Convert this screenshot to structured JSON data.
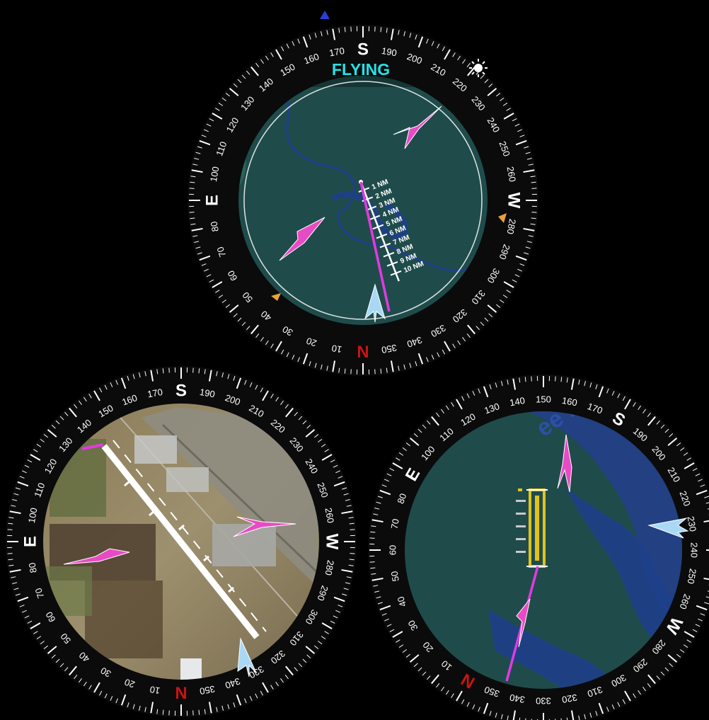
{
  "colors": {
    "background": "#000000",
    "bezel": "#0b0b0b",
    "tick": "#ffffff",
    "north": "#c81414",
    "map_water": "#1f4c4b",
    "river": "#1e3f8a",
    "route": "#e23ae0",
    "traffic": "#e74bc4",
    "ownship": "#a9d8f5",
    "status_text": "#27e0e6",
    "runway_yellow": "#e2c21c",
    "sun": "#ffffff",
    "bearing_orange": "#e7a23a",
    "bearing_blue": "#2b3fd6"
  },
  "top_dial": {
    "status_label": "FLYING",
    "rotation_deg": 180,
    "cardinals": {
      "N": "N",
      "E": "E",
      "S": "S",
      "W": "W"
    },
    "range_rings": [
      "1 NM",
      "2 NM",
      "3 NM",
      "4 NM",
      "5 NM",
      "6 NM",
      "7 NM",
      "8 NM",
      "9 NM",
      "10 NM"
    ],
    "icons": [
      "sun-icon",
      "orange-bearing-bug-icon",
      "blue-bearing-bug-icon",
      "ownship-icon",
      "traffic-icon"
    ]
  },
  "left_dial": {
    "rotation_deg": 180,
    "cardinals": {
      "N": "N",
      "E": "E",
      "S": "S",
      "W": "W"
    },
    "map_style": "satellite-airfield",
    "icons": [
      "ownship-icon",
      "traffic-icon",
      "runway-icon"
    ]
  },
  "right_dial": {
    "rotation_deg": 150,
    "cardinals": {
      "N": "N",
      "E": "E",
      "S": "S",
      "W": "W"
    },
    "map_label": "ee River",
    "icons": [
      "ownship-icon",
      "traffic-icon",
      "runway-icon"
    ]
  }
}
